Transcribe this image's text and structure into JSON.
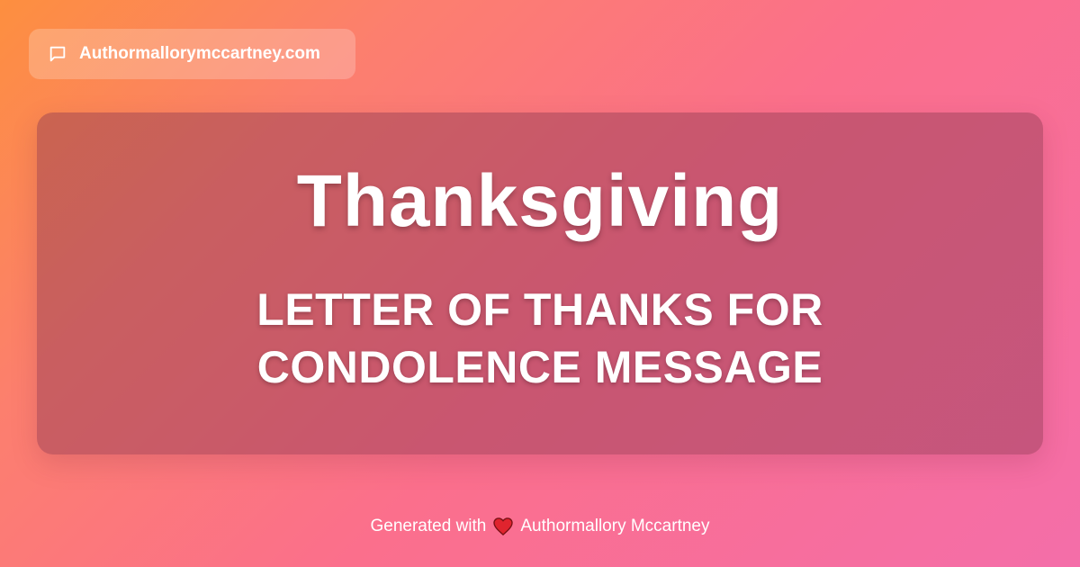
{
  "site": {
    "name": "Authormallorymccartney.com",
    "icon": "message-square-icon"
  },
  "card": {
    "title": "Thanksgiving",
    "subtitle_line1": "LETTER OF THANKS FOR",
    "subtitle_line2": "CONDOLENCE MESSAGE"
  },
  "footer": {
    "prefix": "Generated with",
    "icon": "heart-icon",
    "author": "Authormallory Mccartney"
  },
  "colors": {
    "gradient_start": "#fd8f3f",
    "gradient_end": "#f46ea9",
    "heart": "#e0242e"
  }
}
